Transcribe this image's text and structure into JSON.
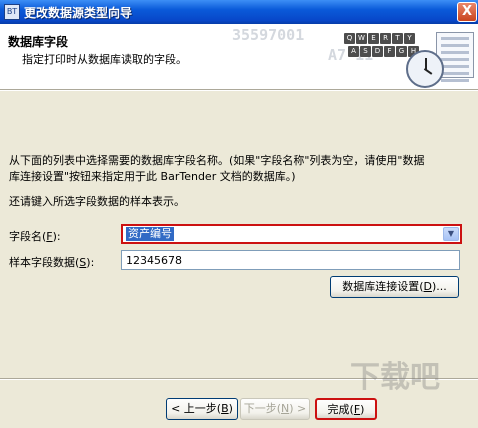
{
  "window": {
    "title": "更改数据源类型向导",
    "close_label": "X",
    "app_icon_label": "BT"
  },
  "header": {
    "title": "数据库字段",
    "subtitle": "指定打印时从数据库读取的字段。",
    "art": {
      "barcode_digits": [
        "35597001",
        "A7-11"
      ],
      "keyboard_row1": [
        "Q",
        "W",
        "E",
        "R",
        "T",
        "Y"
      ],
      "keyboard_row2": [
        "A",
        "S",
        "D",
        "F",
        "G",
        "H"
      ]
    }
  },
  "body": {
    "instructions_line1": "从下面的列表中选择需要的数据库字段名称。(如果\"字段名称\"列表为空，请使用\"数据",
    "instructions_line2": "库连接设置\"按钮来指定用于此 BarTender 文档的数据库。)",
    "sample_prompt": "还请键入所选字段数据的样本表示。",
    "field_name_label": "字段名(",
    "field_name_hotkey": "F",
    "field_name_label_end": "):",
    "field_name_value": "资产编号",
    "sample_label": "样本字段数据(",
    "sample_hotkey": "S",
    "sample_label_end": "):",
    "sample_value": "12345678",
    "db_button_label": "数据库连接设置(",
    "db_button_hotkey": "D",
    "db_button_label_end": ")..."
  },
  "footer": {
    "back_label": "< 上一步(",
    "back_hotkey": "B",
    "back_label_end": ")",
    "next_label": "下一步(",
    "next_hotkey": "N",
    "next_label_end": ") >",
    "finish_label": "完成(",
    "finish_hotkey": "F",
    "finish_label_end": ")"
  },
  "watermark": {
    "text": "下载吧"
  }
}
